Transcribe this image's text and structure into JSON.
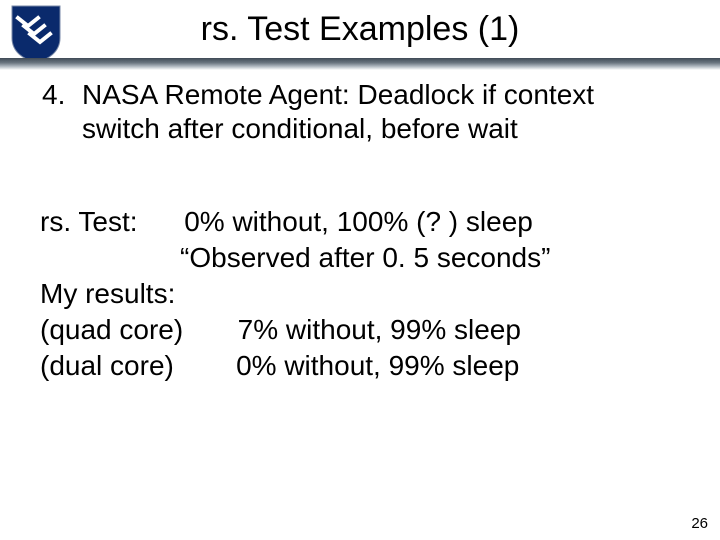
{
  "header": {
    "title": "rs. Test Examples (1)"
  },
  "item": {
    "number": "4.",
    "text": "NASA Remote Agent: Deadlock if context switch after conditional, before wait"
  },
  "results": {
    "rstest_label": "rs. Test:",
    "rstest_line1": "0% without, 100% (? ) sleep",
    "rstest_line2": "“Observed after 0. 5 seconds”",
    "my_label": "My results:",
    "quad_label": "(quad core)",
    "quad_value": "7% without, 99% sleep",
    "dual_label": "(dual core)",
    "dual_value": "0% without, 99% sleep"
  },
  "page_number": "26",
  "logo": {
    "name": "rice-shield-logo"
  }
}
